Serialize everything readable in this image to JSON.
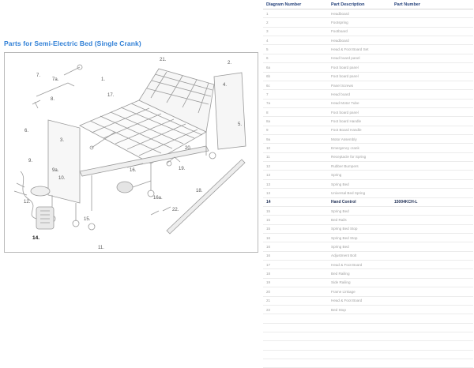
{
  "page_title": "Parts for Semi-Electric Bed (Single Crank)",
  "diagram": {
    "part_labels": [
      "1.",
      "2.",
      "3.",
      "4.",
      "5.",
      "6.",
      "7a.",
      "7.",
      "8.",
      "9.",
      "9a.",
      "10.",
      "11.",
      "12.",
      "13.",
      "14.",
      "15.",
      "16.",
      "16a.",
      "17.",
      "18.",
      "19.",
      "20.",
      "21.",
      "22."
    ],
    "highlighted_part": "14."
  },
  "table": {
    "headers": [
      "Diagram Number",
      "Part Description",
      "Part Number"
    ],
    "rows": [
      [
        "1",
        "Headboard",
        ""
      ],
      [
        "2",
        "Footspring",
        ""
      ],
      [
        "3",
        "Footboard",
        ""
      ],
      [
        "4",
        "Headboard",
        ""
      ],
      [
        "5",
        "Head & Foot Board Set",
        ""
      ],
      [
        "6",
        "Head board panel",
        ""
      ],
      [
        "6a",
        "Foot board panel",
        ""
      ],
      [
        "6b",
        "Foot board panel",
        ""
      ],
      [
        "6c",
        "Panel Screws",
        ""
      ],
      [
        "7",
        "Head board",
        ""
      ],
      [
        "7a",
        "Head Motor Tube",
        ""
      ],
      [
        "8",
        "Foot board panel",
        ""
      ],
      [
        "8a",
        "Foot board Handle",
        ""
      ],
      [
        "9",
        "Foot Board Handle",
        ""
      ],
      [
        "9a",
        "Motor Assembly",
        ""
      ],
      [
        "10",
        "Emergency crank",
        ""
      ],
      [
        "11",
        "Receptacle for Spring",
        ""
      ],
      [
        "12",
        "Rubber Bumpers",
        ""
      ],
      [
        "13",
        "Spring",
        ""
      ],
      [
        "13",
        "Spring Bed",
        ""
      ],
      [
        "13",
        "Universal Bed Spring",
        ""
      ],
      [
        "14",
        "Hand Control",
        "15004KCH-L"
      ],
      [
        "15",
        "Spring Bed",
        ""
      ],
      [
        "15",
        "Bed Rails",
        ""
      ],
      [
        "15",
        "Spring Bed Stop",
        ""
      ],
      [
        "16",
        "Spring Bed Stop",
        ""
      ],
      [
        "16",
        "Spring Bed",
        ""
      ],
      [
        "16",
        "Adjustment Bolt",
        ""
      ],
      [
        "17",
        "Head & Foot Board",
        ""
      ],
      [
        "18",
        "Bed Railing",
        ""
      ],
      [
        "19",
        "Side Railing",
        ""
      ],
      [
        "20",
        "Frame Linkage",
        ""
      ],
      [
        "21",
        "Head & Foot Board",
        ""
      ],
      [
        "22",
        "Bed Stop",
        ""
      ],
      [
        "",
        "",
        ""
      ],
      [
        "",
        "",
        ""
      ],
      [
        "",
        "",
        ""
      ],
      [
        "",
        "",
        ""
      ],
      [
        "",
        "",
        ""
      ],
      [
        "",
        "",
        ""
      ]
    ]
  }
}
